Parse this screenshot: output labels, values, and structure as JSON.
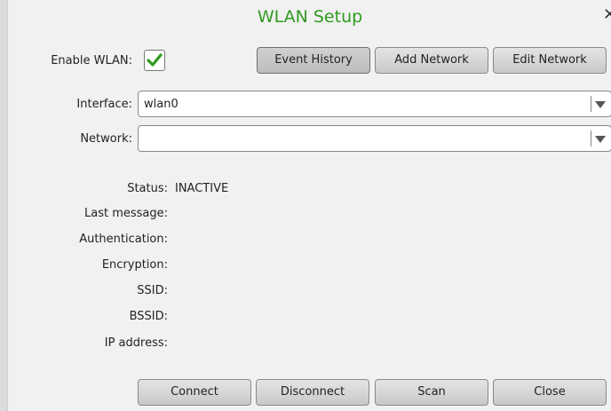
{
  "dialog": {
    "title": "WLAN Setup"
  },
  "enable": {
    "label": "Enable WLAN:",
    "checked": true
  },
  "top_buttons": {
    "event_history": "Event History",
    "add_network": "Add Network",
    "edit_network": "Edit Network"
  },
  "interface": {
    "label": "Interface:",
    "value": "wlan0"
  },
  "network": {
    "label": "Network:",
    "value": ""
  },
  "status": {
    "status_label": "Status:",
    "status_value": "INACTIVE",
    "last_message_label": "Last message:",
    "authentication_label": "Authentication:",
    "encryption_label": "Encryption:",
    "ssid_label": "SSID:",
    "bssid_label": "BSSID:",
    "ip_address_label": "IP address:"
  },
  "bottom_buttons": {
    "connect": "Connect",
    "disconnect": "Disconnect",
    "scan": "Scan",
    "close": "Close"
  },
  "colors": {
    "title": "#2f9b1f",
    "check": "#2f9b1f"
  },
  "icons": {
    "close": "close-icon",
    "check": "checkmark-icon",
    "dropdown": "chevron-down-icon"
  }
}
